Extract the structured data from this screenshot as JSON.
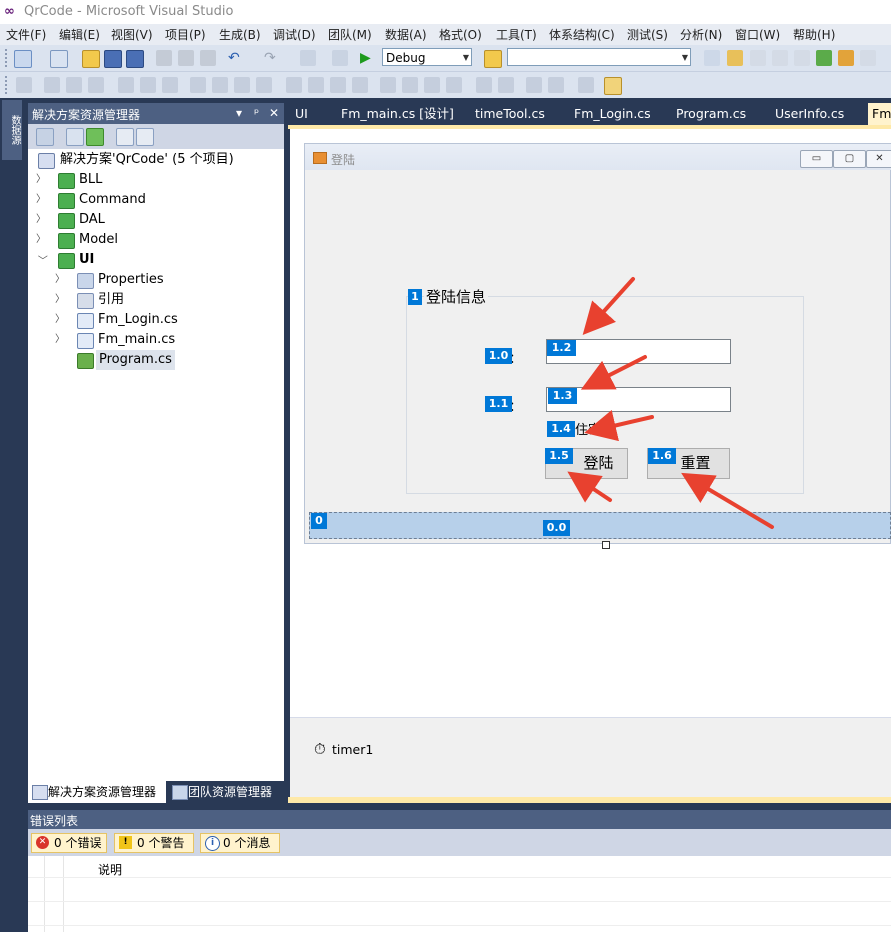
{
  "window": {
    "title": "QrCode - Microsoft Visual Studio"
  },
  "menu": [
    "文件(F)",
    "编辑(E)",
    "视图(V)",
    "项目(P)",
    "生成(B)",
    "调试(D)",
    "团队(M)",
    "数据(A)",
    "格式(O)",
    "工具(T)",
    "体系结构(C)",
    "测试(S)",
    "分析(N)",
    "窗口(W)",
    "帮助(H)"
  ],
  "toolbar": {
    "config": "Debug",
    "search_value": ""
  },
  "left_strip": {
    "tab": "数据源"
  },
  "solution_explorer": {
    "title": "解决方案资源管理器",
    "header_controls": [
      "▾",
      "ᵖ",
      "✕"
    ],
    "solution": "解决方案'QrCode' (5 个项目)",
    "projects": [
      "BLL",
      "Command",
      "DAL",
      "Model",
      "UI"
    ],
    "ui_items": [
      "Properties",
      "引用",
      "Fm_Login.cs",
      "Fm_main.cs",
      "Program.cs"
    ],
    "bottom_tabs": [
      "解决方案资源管理器",
      "团队资源管理器"
    ]
  },
  "doc_tabs": [
    "UI",
    "Fm_main.cs [设计]",
    "timeTool.cs",
    "Fm_Login.cs",
    "Program.cs",
    "UserInfo.cs",
    "Fm_"
  ],
  "form": {
    "title": "登陆",
    "window_buttons": [
      "▭",
      "▢",
      "✕"
    ],
    "group_title": "登陆信息",
    "label_user_suffix": "：",
    "label_pwd_suffix": "：",
    "remember_text": "住密码",
    "login_button": "登陆",
    "reset_button": "重置"
  },
  "badges": [
    "1",
    "1.0",
    "1.1",
    "1.2",
    "1.3",
    "1.4",
    "1.5",
    "1.6",
    "0",
    "0.0"
  ],
  "tray": {
    "component": "timer1"
  },
  "error_list": {
    "title": "错误列表",
    "errors": "0 个错误",
    "warnings": "0 个警告",
    "messages": "0 个消息",
    "column": "说明"
  }
}
